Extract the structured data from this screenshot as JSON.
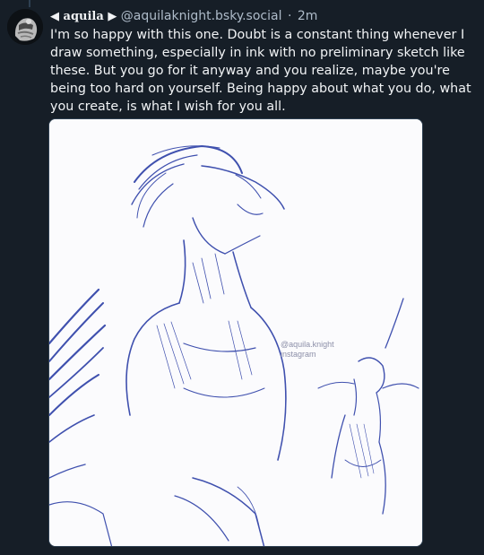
{
  "post": {
    "display_name": "◀ aquila ▶",
    "handle": "@aquilaknight.bsky.social",
    "separator": "·",
    "time": "2m",
    "text": "I'm so happy with this one. Doubt is a constant thing whenever I draw something, especially in ink with no preliminary sketch like these. But you go for it anyway and you realize, maybe you're being too hard on yourself. Being happy about what you do, what you create, is what I wish for you all."
  },
  "media": {
    "watermark_line1": "@aquila.knight",
    "watermark_line2": "instagram",
    "ink_color": "#2b3ea6"
  }
}
